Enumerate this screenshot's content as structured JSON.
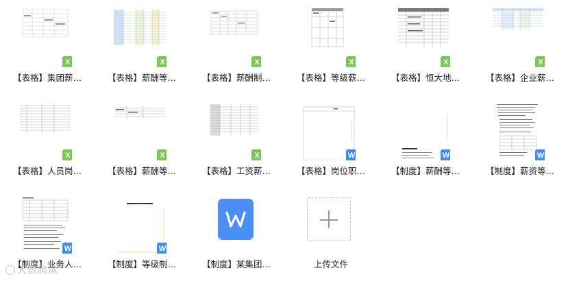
{
  "files": [
    {
      "label": "【表格】集团薪…",
      "type": "x",
      "badge": "X"
    },
    {
      "label": "【表格】薪酬等…",
      "type": "x",
      "badge": "X"
    },
    {
      "label": "【表格】薪酬制…",
      "type": "x",
      "badge": "X"
    },
    {
      "label": "【表格】等级薪…",
      "type": "x",
      "badge": "X"
    },
    {
      "label": "【表格】恒大地…",
      "type": "x",
      "badge": "X"
    },
    {
      "label": "【表格】企业薪…",
      "type": "x",
      "badge": "X"
    },
    {
      "label": "【表格】人员岗…",
      "type": "x",
      "badge": "X"
    },
    {
      "label": "【表格】薪酬等…",
      "type": "x",
      "badge": "X"
    },
    {
      "label": "【表格】工资薪…",
      "type": "x",
      "badge": "X"
    },
    {
      "label": "【表格】岗位职…",
      "type": "w",
      "badge": "W"
    },
    {
      "label": "【制度】薪酬等…",
      "type": "w",
      "badge": "W"
    },
    {
      "label": "【制度】薪资等…",
      "type": "w",
      "badge": "W"
    },
    {
      "label": "【制度】业务人…",
      "type": "w",
      "badge": "W"
    },
    {
      "label": "【制度】等级制…",
      "type": "w",
      "badge": "W"
    },
    {
      "label": "【制度】某集团…",
      "type": "w",
      "badge": "W"
    }
  ],
  "upload": {
    "label": "上传文件"
  },
  "watermark": {
    "text": "大数跨境"
  },
  "big_icon": {
    "letter": "W"
  }
}
